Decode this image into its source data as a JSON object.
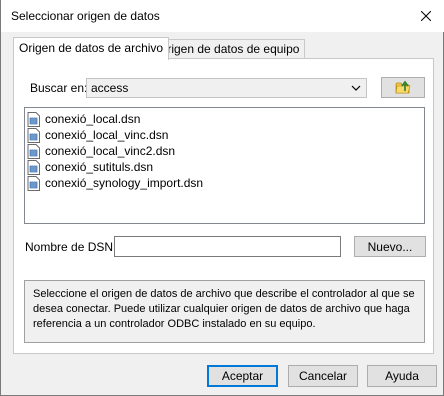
{
  "window": {
    "title": "Seleccionar origen de datos",
    "close_glyph": "close-icon"
  },
  "tabs": [
    {
      "label": "Origen de datos de archivo",
      "active": true
    },
    {
      "label": "Origen de datos de equipo",
      "active": false
    }
  ],
  "look_in": {
    "label": "Buscar en:",
    "value": "access",
    "up_button_icon": "folder-up-icon"
  },
  "files": [
    {
      "name": "conexió_local.dsn",
      "icon": "dsn-file-icon"
    },
    {
      "name": "conexió_local_vinc.dsn",
      "icon": "dsn-file-icon"
    },
    {
      "name": "conexió_local_vinc2.dsn",
      "icon": "dsn-file-icon"
    },
    {
      "name": "conexió_sutituls.dsn",
      "icon": "dsn-file-icon"
    },
    {
      "name": "conexió_synology_import.dsn",
      "icon": "dsn-file-icon"
    }
  ],
  "dsn": {
    "label": "Nombre de DSN:",
    "value": "",
    "new_button": "Nuevo..."
  },
  "description": "Seleccione el origen de datos de archivo que describe el controlador al que se desea conectar. Puede utilizar cualquier origen de datos de archivo que haga referencia a un controlador ODBC instalado en su equipo.",
  "buttons": {
    "accept": "Aceptar",
    "cancel": "Cancelar",
    "help": "Ayuda"
  },
  "colors": {
    "accent": "#0078d7",
    "dialog_bg": "#f0f0f0",
    "panel_bg": "#ffffff"
  }
}
